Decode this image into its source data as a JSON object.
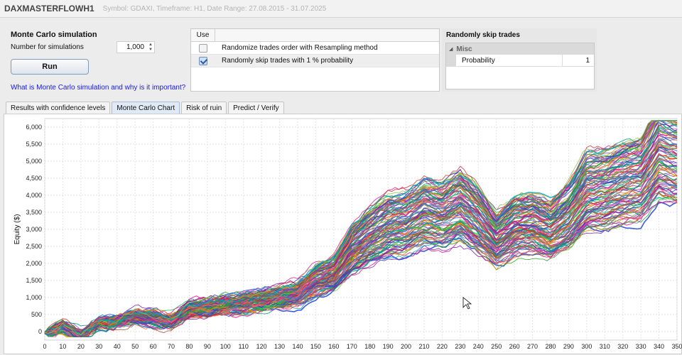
{
  "window": {
    "title": "DAXMASTERFLOWH1",
    "subtitle": "Symbol: GDAXI, Timeframe: H1, Date Range: 27.08.2015 - 31.07.2025"
  },
  "mc_panel": {
    "title": "Monte Carlo simulation",
    "sims_label": "Number for simulations",
    "sims_value": "1,000",
    "run_label": "Run",
    "help_link": "What is Monte Carlo simulation and why is it important?"
  },
  "options": {
    "use_header": "Use",
    "rows": [
      {
        "label": "Randomize trades order with Resampling method",
        "checked": false
      },
      {
        "label": "Randomly skip trades with 1 % probability",
        "checked": true
      }
    ]
  },
  "skip_panel": {
    "title": "Randomly skip trades",
    "category": "Misc",
    "property_name": "Probability",
    "property_value": "1"
  },
  "tabs": [
    {
      "label": "Results with confidence levels",
      "active": false
    },
    {
      "label": "Monte Carlo Chart",
      "active": true
    },
    {
      "label": "Risk of ruin",
      "active": false
    },
    {
      "label": "Predict / Verify",
      "active": false
    }
  ],
  "chart_data": {
    "type": "line",
    "title": "",
    "xlabel": "",
    "ylabel": "Equity ($)",
    "xlim": [
      0,
      350
    ],
    "ylim": [
      -250,
      6250
    ],
    "x_ticks": [
      0,
      10,
      20,
      30,
      40,
      50,
      60,
      70,
      80,
      90,
      100,
      110,
      120,
      130,
      140,
      150,
      160,
      170,
      180,
      190,
      200,
      210,
      220,
      230,
      240,
      250,
      260,
      270,
      280,
      290,
      300,
      310,
      320,
      330,
      340,
      350
    ],
    "y_ticks": [
      0,
      500,
      1000,
      1500,
      2000,
      2500,
      3000,
      3500,
      4000,
      4500,
      5000,
      5500,
      6000
    ],
    "y_tick_labels": [
      "0",
      "500",
      "1,000",
      "1,500",
      "2,000",
      "2,500",
      "3,000",
      "3,500",
      "4,000",
      "4,500",
      "5,000",
      "5,500",
      "6,000"
    ],
    "grid": true,
    "series_count_shown": 120,
    "median_path": {
      "x": [
        0,
        10,
        20,
        30,
        40,
        50,
        60,
        70,
        80,
        90,
        100,
        110,
        120,
        130,
        140,
        150,
        160,
        170,
        180,
        190,
        200,
        210,
        220,
        230,
        240,
        250,
        260,
        270,
        280,
        290,
        300,
        310,
        320,
        330,
        340,
        350
      ],
      "y": [
        -50,
        150,
        -100,
        250,
        300,
        450,
        400,
        300,
        650,
        700,
        800,
        850,
        900,
        1000,
        1100,
        1500,
        1700,
        2400,
        2800,
        3100,
        3200,
        3500,
        3400,
        3700,
        3300,
        2700,
        3100,
        3200,
        3000,
        3400,
        4100,
        4200,
        4400,
        4500,
        5300,
        5150
      ]
    },
    "colors": [
      "#1f3fd8",
      "#e0148a",
      "#7b1fa2",
      "#2e9d2e",
      "#f08c00",
      "#00a5b8",
      "#d32f2f",
      "#8bc34a",
      "#5c6bc0",
      "#ff4fa3",
      "#008b8b",
      "#a0522d",
      "#6a5acd",
      "#00c853",
      "#ff7043",
      "#3949ab"
    ]
  }
}
